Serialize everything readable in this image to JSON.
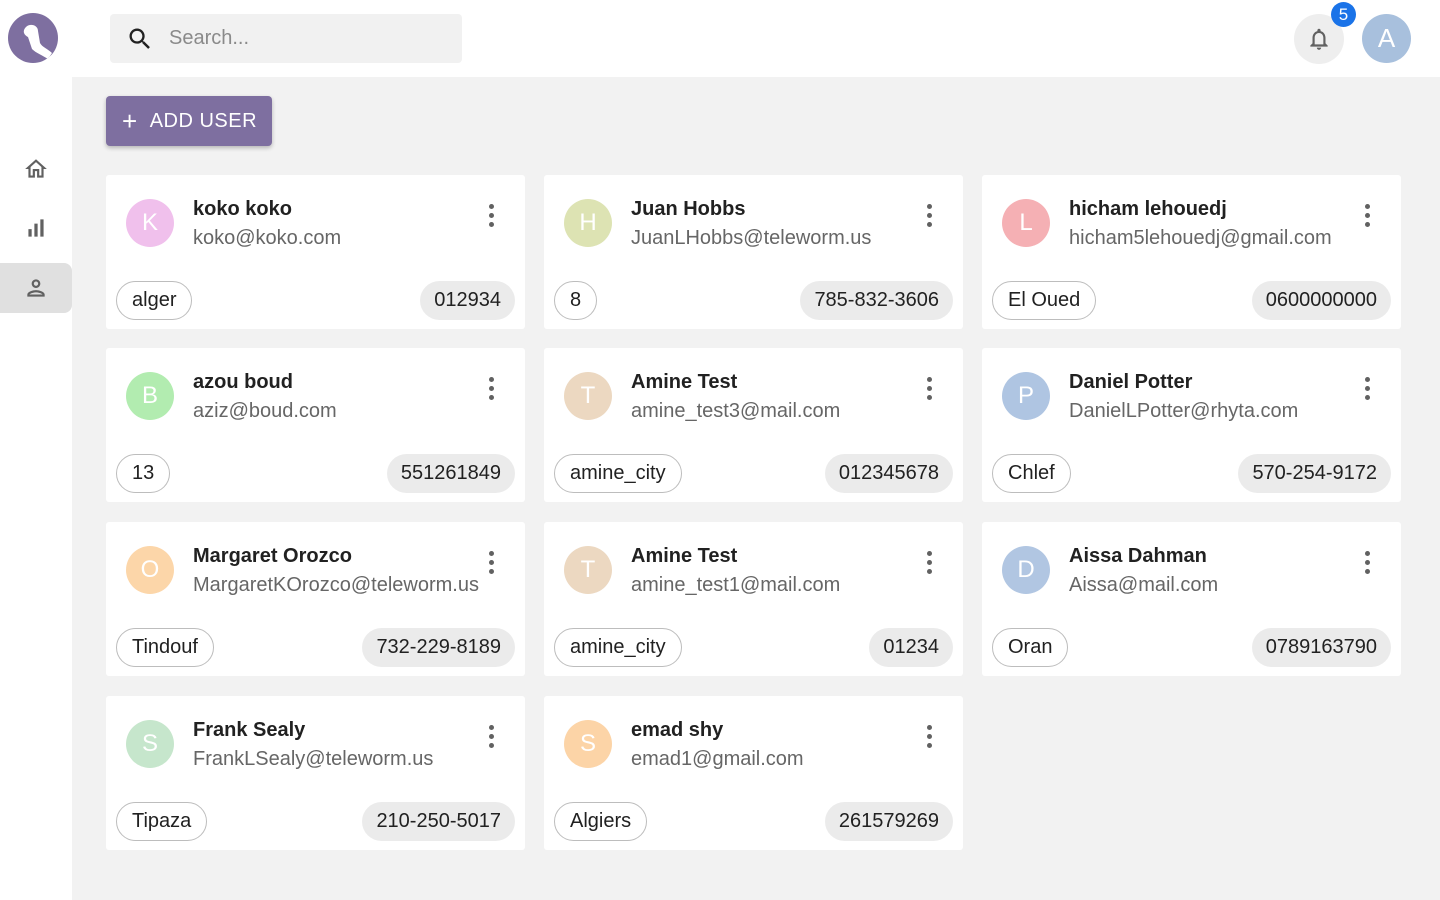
{
  "nav": {
    "items": [
      {
        "name": "home",
        "icon": "home-icon"
      },
      {
        "name": "stats",
        "icon": "bar-chart-icon"
      },
      {
        "name": "users",
        "icon": "person-icon",
        "active": true
      }
    ]
  },
  "search": {
    "placeholder": "Search..."
  },
  "notifications": {
    "count": "5"
  },
  "user": {
    "initial": "A",
    "color": "#a8c0dd"
  },
  "toolbar": {
    "add_user_label": "ADD USER",
    "add_icon": "+"
  },
  "users": [
    {
      "initial": "K",
      "color": "#f0c0ec",
      "name": "koko koko",
      "email": "koko@koko.com",
      "city": "alger",
      "phone": "012934"
    },
    {
      "initial": "H",
      "color": "#dde3b3",
      "name": "Juan Hobbs",
      "email": "JuanLHobbs@teleworm.us",
      "city": "8",
      "phone": "785-832-3606"
    },
    {
      "initial": "L",
      "color": "#f5b0b4",
      "name": "hicham lehouedj",
      "email": "hicham5lehouedj@gmail.com",
      "city": "El Oued",
      "phone": "0600000000"
    },
    {
      "initial": "B",
      "color": "#b2ecb0",
      "name": "azou boud",
      "email": "aziz@boud.com",
      "city": "13",
      "phone": "551261849"
    },
    {
      "initial": "T",
      "color": "#ecd8c1",
      "name": "Amine Test",
      "email": "amine_test3@mail.com",
      "city": "amine_city",
      "phone": "012345678"
    },
    {
      "initial": "P",
      "color": "#afc5e2",
      "name": "Daniel Potter",
      "email": "DanielLPotter@rhyta.com",
      "city": "Chlef",
      "phone": "570-254-9172"
    },
    {
      "initial": "O",
      "color": "#fcd6a9",
      "name": "Margaret Orozco",
      "email": "MargaretKOrozco@teleworm.us",
      "city": "Tindouf",
      "phone": "732-229-8189"
    },
    {
      "initial": "T",
      "color": "#ecd8c1",
      "name": "Amine Test",
      "email": "amine_test1@mail.com",
      "city": "amine_city",
      "phone": "01234"
    },
    {
      "initial": "D",
      "color": "#b1c6e2",
      "name": "Aissa Dahman",
      "email": "Aissa@mail.com",
      "city": "Oran",
      "phone": "0789163790"
    },
    {
      "initial": "S",
      "color": "#c6e6cc",
      "name": "Frank Sealy",
      "email": "FrankLSealy@teleworm.us",
      "city": "Tipaza",
      "phone": "210-250-5017"
    },
    {
      "initial": "S",
      "color": "#fcd4a7",
      "name": "emad shy",
      "email": "emad1@gmail.com",
      "city": "Algiers",
      "phone": "261579269"
    }
  ]
}
